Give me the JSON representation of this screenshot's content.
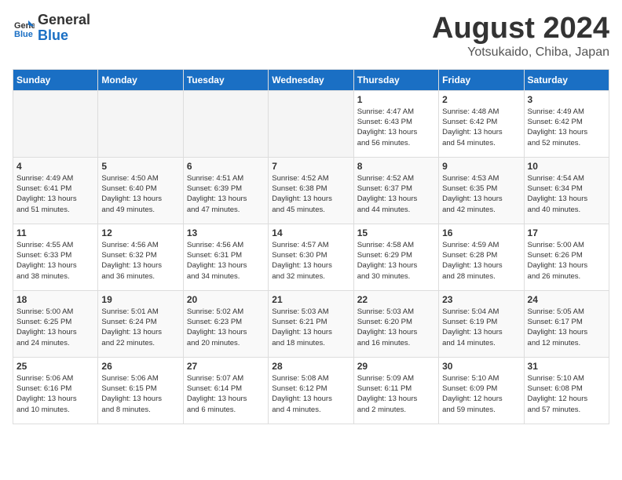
{
  "header": {
    "logo_line1": "General",
    "logo_line2": "Blue",
    "title": "August 2024",
    "subtitle": "Yotsukaido, Chiba, Japan"
  },
  "weekdays": [
    "Sunday",
    "Monday",
    "Tuesday",
    "Wednesday",
    "Thursday",
    "Friday",
    "Saturday"
  ],
  "weeks": [
    [
      {
        "day": "",
        "info": ""
      },
      {
        "day": "",
        "info": ""
      },
      {
        "day": "",
        "info": ""
      },
      {
        "day": "",
        "info": ""
      },
      {
        "day": "1",
        "info": "Sunrise: 4:47 AM\nSunset: 6:43 PM\nDaylight: 13 hours\nand 56 minutes."
      },
      {
        "day": "2",
        "info": "Sunrise: 4:48 AM\nSunset: 6:42 PM\nDaylight: 13 hours\nand 54 minutes."
      },
      {
        "day": "3",
        "info": "Sunrise: 4:49 AM\nSunset: 6:42 PM\nDaylight: 13 hours\nand 52 minutes."
      }
    ],
    [
      {
        "day": "4",
        "info": "Sunrise: 4:49 AM\nSunset: 6:41 PM\nDaylight: 13 hours\nand 51 minutes."
      },
      {
        "day": "5",
        "info": "Sunrise: 4:50 AM\nSunset: 6:40 PM\nDaylight: 13 hours\nand 49 minutes."
      },
      {
        "day": "6",
        "info": "Sunrise: 4:51 AM\nSunset: 6:39 PM\nDaylight: 13 hours\nand 47 minutes."
      },
      {
        "day": "7",
        "info": "Sunrise: 4:52 AM\nSunset: 6:38 PM\nDaylight: 13 hours\nand 45 minutes."
      },
      {
        "day": "8",
        "info": "Sunrise: 4:52 AM\nSunset: 6:37 PM\nDaylight: 13 hours\nand 44 minutes."
      },
      {
        "day": "9",
        "info": "Sunrise: 4:53 AM\nSunset: 6:35 PM\nDaylight: 13 hours\nand 42 minutes."
      },
      {
        "day": "10",
        "info": "Sunrise: 4:54 AM\nSunset: 6:34 PM\nDaylight: 13 hours\nand 40 minutes."
      }
    ],
    [
      {
        "day": "11",
        "info": "Sunrise: 4:55 AM\nSunset: 6:33 PM\nDaylight: 13 hours\nand 38 minutes."
      },
      {
        "day": "12",
        "info": "Sunrise: 4:56 AM\nSunset: 6:32 PM\nDaylight: 13 hours\nand 36 minutes."
      },
      {
        "day": "13",
        "info": "Sunrise: 4:56 AM\nSunset: 6:31 PM\nDaylight: 13 hours\nand 34 minutes."
      },
      {
        "day": "14",
        "info": "Sunrise: 4:57 AM\nSunset: 6:30 PM\nDaylight: 13 hours\nand 32 minutes."
      },
      {
        "day": "15",
        "info": "Sunrise: 4:58 AM\nSunset: 6:29 PM\nDaylight: 13 hours\nand 30 minutes."
      },
      {
        "day": "16",
        "info": "Sunrise: 4:59 AM\nSunset: 6:28 PM\nDaylight: 13 hours\nand 28 minutes."
      },
      {
        "day": "17",
        "info": "Sunrise: 5:00 AM\nSunset: 6:26 PM\nDaylight: 13 hours\nand 26 minutes."
      }
    ],
    [
      {
        "day": "18",
        "info": "Sunrise: 5:00 AM\nSunset: 6:25 PM\nDaylight: 13 hours\nand 24 minutes."
      },
      {
        "day": "19",
        "info": "Sunrise: 5:01 AM\nSunset: 6:24 PM\nDaylight: 13 hours\nand 22 minutes."
      },
      {
        "day": "20",
        "info": "Sunrise: 5:02 AM\nSunset: 6:23 PM\nDaylight: 13 hours\nand 20 minutes."
      },
      {
        "day": "21",
        "info": "Sunrise: 5:03 AM\nSunset: 6:21 PM\nDaylight: 13 hours\nand 18 minutes."
      },
      {
        "day": "22",
        "info": "Sunrise: 5:03 AM\nSunset: 6:20 PM\nDaylight: 13 hours\nand 16 minutes."
      },
      {
        "day": "23",
        "info": "Sunrise: 5:04 AM\nSunset: 6:19 PM\nDaylight: 13 hours\nand 14 minutes."
      },
      {
        "day": "24",
        "info": "Sunrise: 5:05 AM\nSunset: 6:17 PM\nDaylight: 13 hours\nand 12 minutes."
      }
    ],
    [
      {
        "day": "25",
        "info": "Sunrise: 5:06 AM\nSunset: 6:16 PM\nDaylight: 13 hours\nand 10 minutes."
      },
      {
        "day": "26",
        "info": "Sunrise: 5:06 AM\nSunset: 6:15 PM\nDaylight: 13 hours\nand 8 minutes."
      },
      {
        "day": "27",
        "info": "Sunrise: 5:07 AM\nSunset: 6:14 PM\nDaylight: 13 hours\nand 6 minutes."
      },
      {
        "day": "28",
        "info": "Sunrise: 5:08 AM\nSunset: 6:12 PM\nDaylight: 13 hours\nand 4 minutes."
      },
      {
        "day": "29",
        "info": "Sunrise: 5:09 AM\nSunset: 6:11 PM\nDaylight: 13 hours\nand 2 minutes."
      },
      {
        "day": "30",
        "info": "Sunrise: 5:10 AM\nSunset: 6:09 PM\nDaylight: 12 hours\nand 59 minutes."
      },
      {
        "day": "31",
        "info": "Sunrise: 5:10 AM\nSunset: 6:08 PM\nDaylight: 12 hours\nand 57 minutes."
      }
    ]
  ]
}
